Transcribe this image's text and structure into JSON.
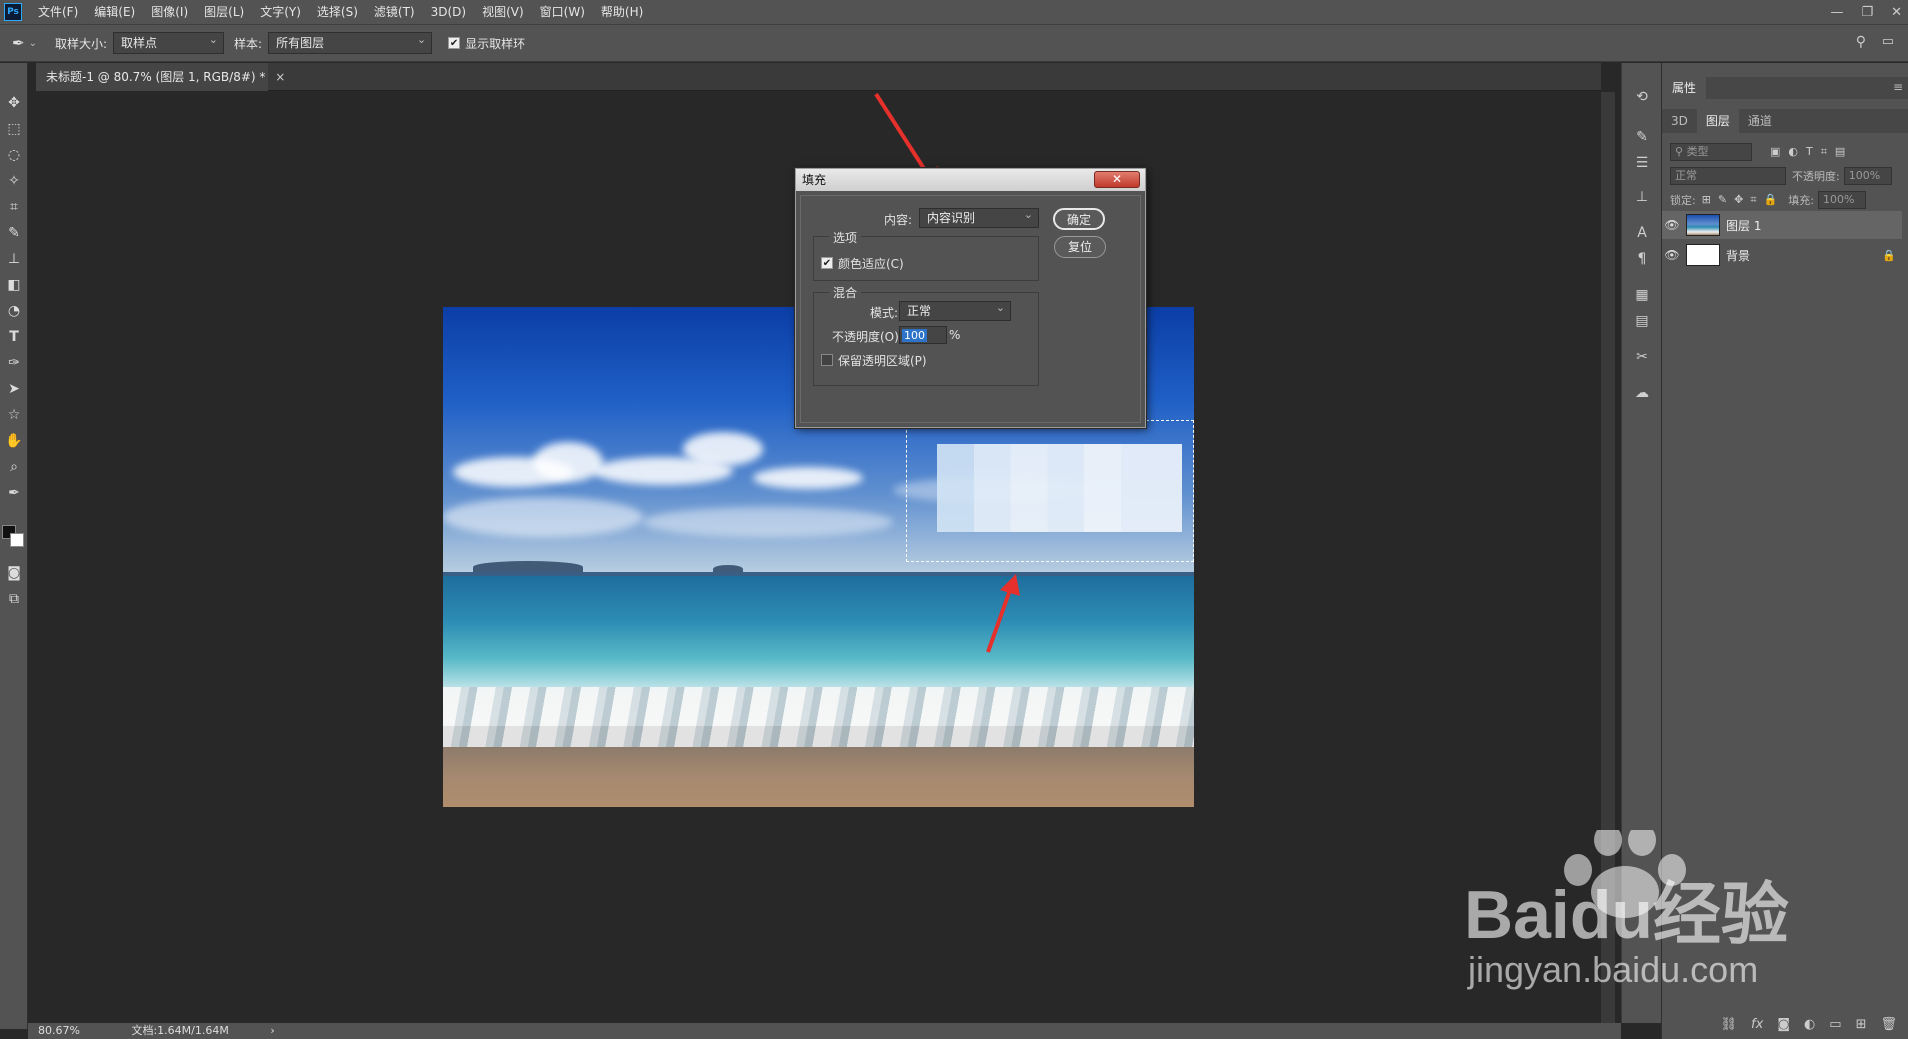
{
  "app": {
    "logo": "Ps"
  },
  "menu": [
    "文件(F)",
    "编辑(E)",
    "图像(I)",
    "图层(L)",
    "文字(Y)",
    "选择(S)",
    "滤镜(T)",
    "3D(D)",
    "视图(V)",
    "窗口(W)",
    "帮助(H)"
  ],
  "options_bar": {
    "sample_size_label": "取样大小:",
    "sample_size_value": "取样点",
    "sample_label": "样本:",
    "sample_value": "所有图层",
    "show_ring_label": "显示取样环"
  },
  "document": {
    "tab_title": "未标题-1 @ 80.7% (图层 1, RGB/8#) *",
    "close": "×"
  },
  "dialog": {
    "title": "填充",
    "close": "✕",
    "content_label": "内容:",
    "content_value": "内容识别",
    "ok": "确定",
    "reset": "复位",
    "options_group": "选项",
    "color_adapt": "颜色适应(C)",
    "blend_group": "混合",
    "mode_label": "模式:",
    "mode_value": "正常",
    "opacity_label": "不透明度(O):",
    "opacity_value": "100",
    "percent": "%",
    "preserve": "保留透明区域(P)"
  },
  "panels": {
    "properties_tab": "属性",
    "tabs": [
      "3D",
      "图层",
      "通道"
    ],
    "search_placeholder": "类型",
    "blend_mode": "正常",
    "opacity_label": "不透明度:",
    "opacity_value": "100%",
    "lock_label": "锁定:",
    "fill_label": "填充:",
    "fill_value": "100%",
    "layers": [
      {
        "name": "图层 1"
      },
      {
        "name": "背景"
      }
    ]
  },
  "status": {
    "zoom": "80.67%",
    "doc": "文档:1.64M/1.64M",
    "arrow": "›"
  },
  "watermark": {
    "brand": "Baidu经验",
    "url": "jingyan.baidu.com"
  },
  "colors": {
    "accent_red": "#e5302b",
    "selection_blue": "#2d73c8",
    "panel": "#535353",
    "canvas": "#282828"
  }
}
